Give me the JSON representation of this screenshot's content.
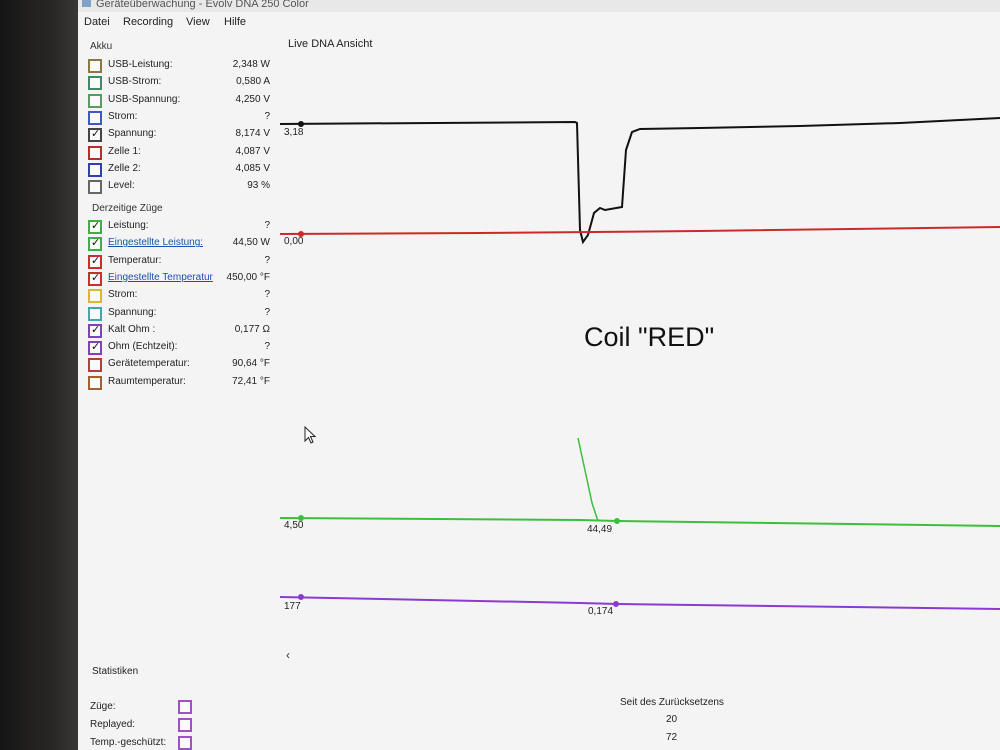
{
  "window": {
    "title": "Geräteüberwachung - Evolv DNA 250 Color"
  },
  "menu": [
    {
      "label": "Datei"
    },
    {
      "label": "Recording"
    },
    {
      "label": "View"
    },
    {
      "label": "Hilfe"
    }
  ],
  "akku": {
    "title": "Akku",
    "items": [
      {
        "label": "USB-Leistung:",
        "value": "2,348 W",
        "checked": false,
        "color": "#8a7a40"
      },
      {
        "label": "USB-Strom:",
        "value": "0,580 A",
        "checked": false,
        "color": "#3c8a6a"
      },
      {
        "label": "USB-Spannung:",
        "value": "4,250 V",
        "checked": false,
        "color": "#5a9a60"
      },
      {
        "label": "Strom:",
        "value": "?",
        "checked": false,
        "color": "#3f57c8"
      },
      {
        "label": "Spannung:",
        "value": "8,174 V",
        "checked": true,
        "color": "#444444"
      },
      {
        "label": "Zelle 1:",
        "value": "4,087 V",
        "checked": false,
        "color": "#b03030"
      },
      {
        "label": "Zelle 2:",
        "value": "4,085 V",
        "checked": false,
        "color": "#3040b0"
      },
      {
        "label": "Level:",
        "value": "93 %",
        "checked": false,
        "color": "#666666"
      }
    ]
  },
  "zuege": {
    "title": "Derzeitige Züge",
    "items": [
      {
        "label": "Leistung:",
        "value": "?",
        "checked": true,
        "color": "#3cb043",
        "link": false
      },
      {
        "label": "Eingestellte Leistung:",
        "value": "44,50 W",
        "checked": true,
        "color": "#3cb043",
        "link": true
      },
      {
        "label": "Temperatur:",
        "value": "?",
        "checked": true,
        "color": "#c83030",
        "link": false
      },
      {
        "label": "Eingestellte Temperatur",
        "value": "450,00 °F",
        "checked": true,
        "color": "#c83030",
        "link": true
      },
      {
        "label": "Strom:",
        "value": "?",
        "checked": false,
        "color": "#d8b830",
        "link": false
      },
      {
        "label": "Spannung:",
        "value": "?",
        "checked": false,
        "color": "#40a8a8",
        "link": false
      },
      {
        "label": "Kalt Ohm :",
        "value": "0,177 Ω",
        "checked": true,
        "color": "#8040c0",
        "link": false
      },
      {
        "label": "Ohm (Echtzeit):",
        "value": "?",
        "checked": true,
        "color": "#8040c0",
        "link": false
      },
      {
        "label": "Gerätetemperatur:",
        "value": "90,64 °F",
        "checked": false,
        "color": "#b04040",
        "link": false
      },
      {
        "label": "Raumtemperatur:",
        "value": "72,41 °F",
        "checked": false,
        "color": "#a06030",
        "link": false
      }
    ]
  },
  "graph": {
    "title": "Live DNA Ansicht",
    "annotation": "Coil \"RED\"",
    "labels": {
      "voltage": "3,18",
      "temperature": "0,00",
      "power": "4,50",
      "power_point": "44,49",
      "ohm": "177",
      "ohm_point": "0,174"
    },
    "colors": {
      "voltage": "#111111",
      "temperature": "#cc2a2a",
      "power": "#3cbf3c",
      "ohm": "#8a3ad0"
    }
  },
  "statistiken": {
    "title": "Statistiken",
    "rows": [
      {
        "label": "Züge:"
      },
      {
        "label": "Replayed:"
      },
      {
        "label": "Temp.-geschützt:"
      }
    ],
    "since_reset_label": "Seit des Zurücksetzens",
    "values": [
      "20",
      "72"
    ]
  }
}
